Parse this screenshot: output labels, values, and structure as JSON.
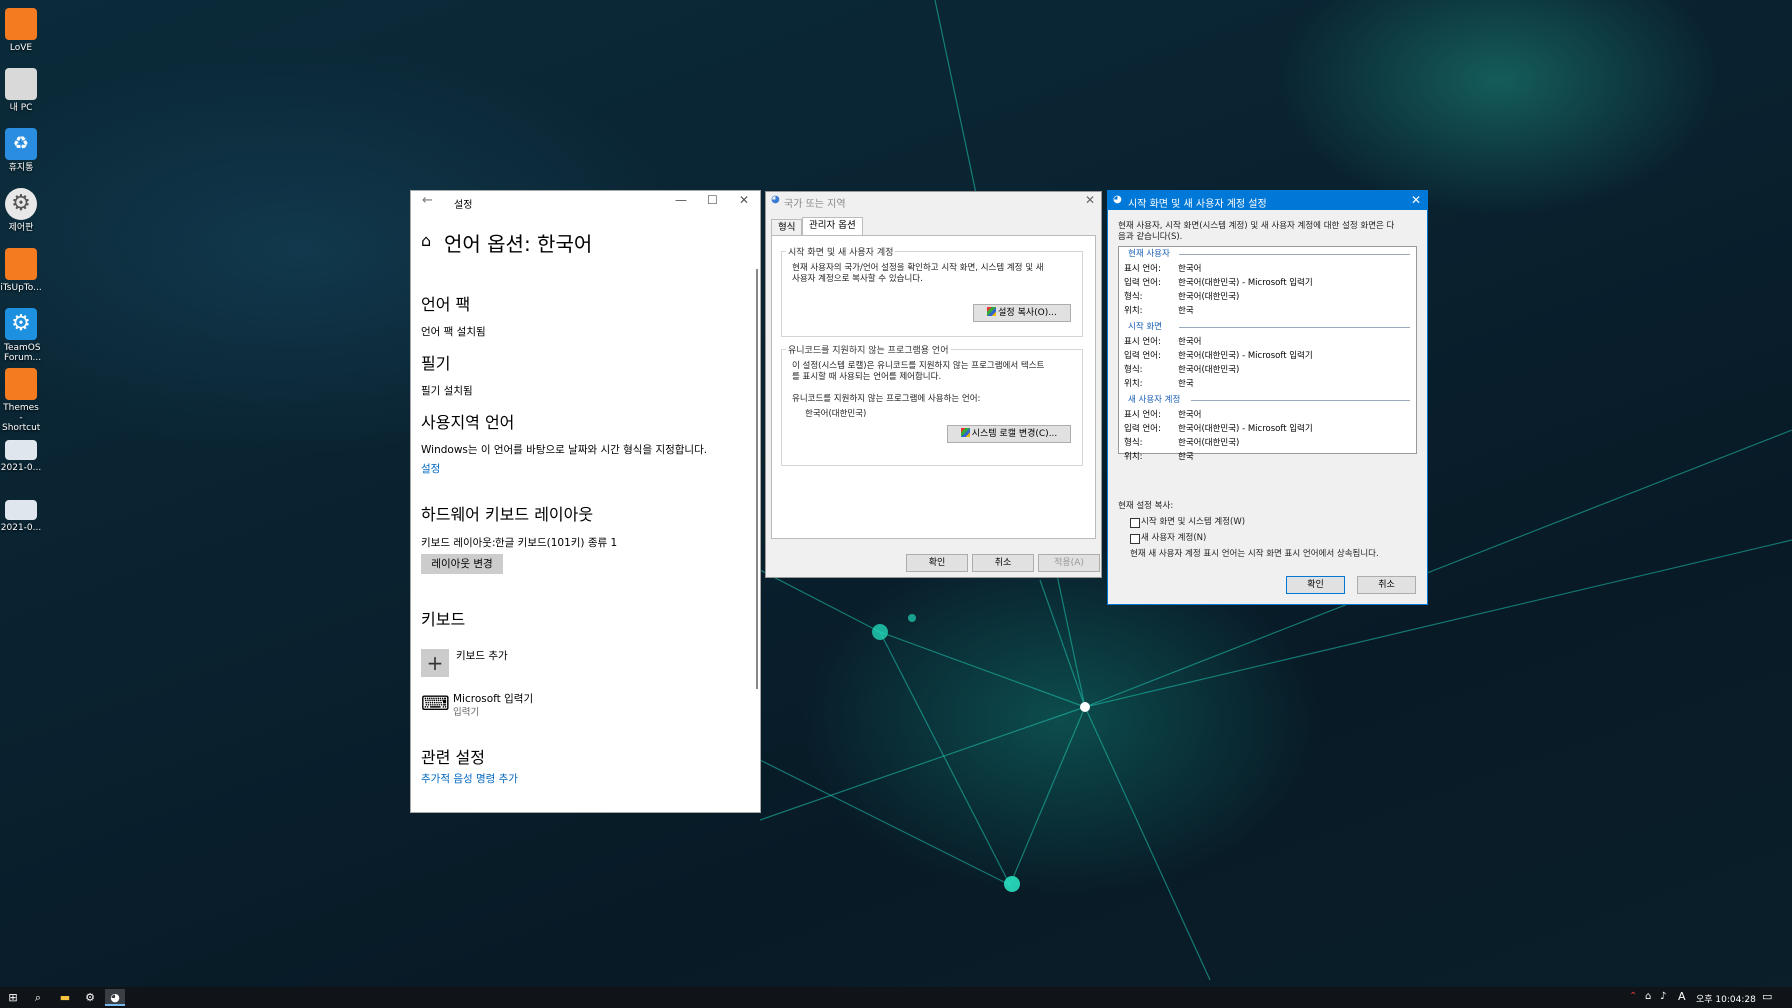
{
  "desktop": {
    "icons": [
      {
        "label": "LoVE",
        "icon": "orange-folder-icon",
        "color": "#f47b20"
      },
      {
        "label": "내 PC",
        "icon": "this-pc-folder-icon",
        "color": "#d9d9d9"
      },
      {
        "label": "휴지통",
        "icon": "recycle-bin-icon",
        "color": "#2a8de0"
      },
      {
        "label": "제어판",
        "icon": "control-panel-icon",
        "color": "#555555"
      },
      {
        "label": "iTsUpTo...",
        "icon": "itsupto-app-icon",
        "color": "#f47b20"
      },
      {
        "label": "TeamOS Forum...",
        "icon": "teamos-gear-icon",
        "color": "#1e90e0"
      },
      {
        "label": "Themes - Shortcut",
        "icon": "themes-shortcut-icon",
        "color": "#f47b20"
      },
      {
        "label": "2021-0...",
        "icon": "screenshot-file-icon",
        "color": "#dfe6ee"
      },
      {
        "label": "2021-0...",
        "icon": "screenshot-file-icon",
        "color": "#dfe6ee"
      }
    ]
  },
  "settings": {
    "window_title": "설정",
    "page_title": "언어 옵션: 한국어",
    "language_pack_heading": "언어 팩",
    "language_pack_status": "언어 팩 설치됨",
    "handwriting_heading": "필기",
    "handwriting_status": "필기 설치됨",
    "regional_heading": "사용지역 언어",
    "regional_desc": "Windows는 이 언어를 바탕으로 날짜와 시간 형식을 지정합니다.",
    "regional_link": "설정",
    "hw_keyboard_heading": "하드웨어 키보드 레이아웃",
    "keyboard_layout_label": "키보드 레이아웃:",
    "keyboard_layout_value": "한글 키보드(101키) 종류 1",
    "change_layout_button": "레이아웃 변경",
    "keyboard_heading": "키보드",
    "add_keyboard": "키보드 추가",
    "ime_name": "Microsoft 입력기",
    "ime_type": "입력기",
    "related_heading": "관련 설정",
    "related_link": "추가적 음성 명령 추가"
  },
  "region": {
    "window_title": "국가 또는 지역",
    "tabs": [
      "형식",
      "관리자 옵션"
    ],
    "group1_title": "시작 화면 및 새 사용자 계정",
    "group1_desc_1": "현재 사용자의 국가/언어 설정을 확인하고 시작 화면, 시스템 계정 및 새",
    "group1_desc_2": "사용자 계정으로 복사할 수 있습니다.",
    "copy_settings_button": "설정 복사(O)...",
    "group2_title": "유니코드를 지원하지 않는 프로그램용 언어",
    "group2_desc_1": "이 설정(시스템 로캘)은 유니코드를 지원하지 않는 프로그램에서 텍스트",
    "group2_desc_2": "를 표시할 때 사용되는 언어를 제어합니다.",
    "current_language_label": "유니코드를 지원하지 않는 프로그램에 사용하는 언어:",
    "current_language_value": "한국어(대한민국)",
    "change_locale_button": "시스템 로캘 변경(C)...",
    "ok_button": "확인",
    "cancel_button": "취소",
    "apply_button": "적용(A)"
  },
  "newuser": {
    "window_title": "시작 화면 및 새 사용자 계정 설정",
    "intro_1": "현재 사용자, 시작 화면(시스템 계정) 및 새 사용자 계정에 대한 설정 화면은 다",
    "intro_2": "음과 같습니다(S).",
    "sections": [
      {
        "title": "현재 사용자",
        "rows": [
          {
            "key": "표시 언어:",
            "value": "한국어"
          },
          {
            "key": "입력 언어:",
            "value": "한국어(대한민국) - Microsoft 입력기"
          },
          {
            "key": "형식:",
            "value": "한국어(대한민국)"
          },
          {
            "key": "위치:",
            "value": "한국"
          }
        ]
      },
      {
        "title": "시작 화면",
        "rows": [
          {
            "key": "표시 언어:",
            "value": "한국어"
          },
          {
            "key": "입력 언어:",
            "value": "한국어(대한민국) - Microsoft 입력기"
          },
          {
            "key": "형식:",
            "value": "한국어(대한민국)"
          },
          {
            "key": "위치:",
            "value": "한국"
          }
        ]
      },
      {
        "title": "새 사용자 계정",
        "rows": [
          {
            "key": "표시 언어:",
            "value": "한국어"
          },
          {
            "key": "입력 언어:",
            "value": "한국어(대한민국) - Microsoft 입력기"
          },
          {
            "key": "형식:",
            "value": "한국어(대한민국)"
          },
          {
            "key": "위치:",
            "value": "한국"
          }
        ]
      }
    ],
    "copy_label": "현재 설정 복사:",
    "checkbox_1": "시작 화면 및 시스템 계정(W)",
    "checkbox_2": "새 사용자 계정(N)",
    "note": "현재 새 사용자 계정 표시 언어는 시작 화면 표시 언어에서 상속됩니다.",
    "ok_button": "확인",
    "cancel_button": "취소"
  },
  "taskbar": {
    "ime_indicator": "A",
    "clock": "오후 10:04:28",
    "apps": [
      "start-icon",
      "search-icon",
      "file-explorer-icon",
      "settings-icon",
      "region-app-icon"
    ]
  }
}
